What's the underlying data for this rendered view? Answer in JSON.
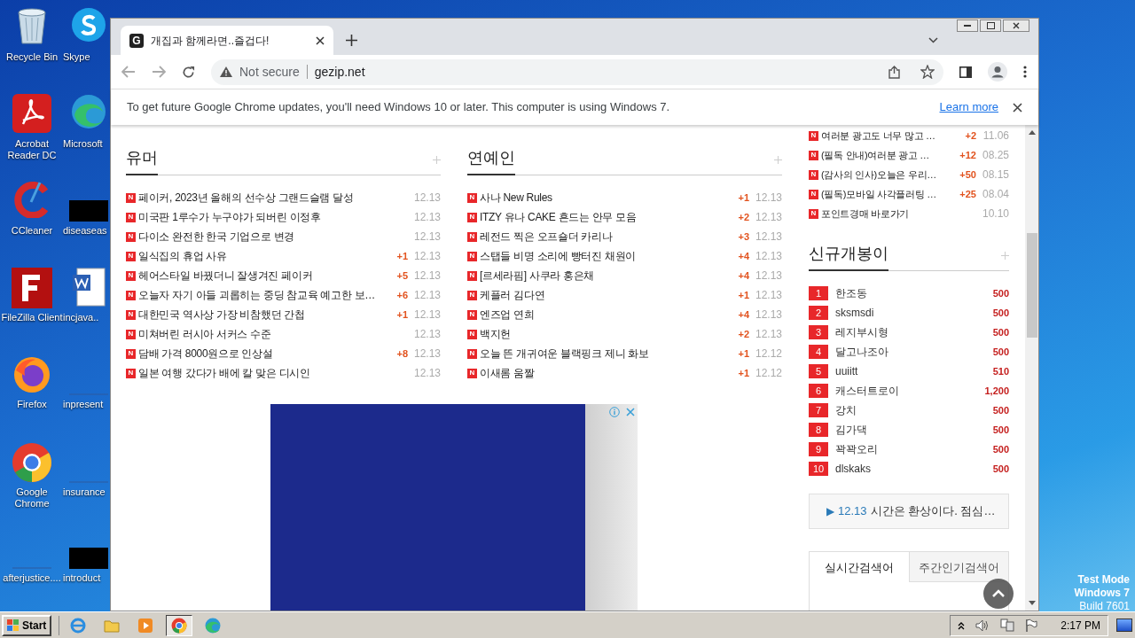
{
  "desktop": {
    "icons": [
      {
        "label": "Recycle Bin",
        "kind": "recycle"
      },
      {
        "label": "Acrobat Reader DC",
        "kind": "acrobat"
      },
      {
        "label": "CCleaner",
        "kind": "ccleaner"
      },
      {
        "label": "FileZilla Client",
        "kind": "filezilla"
      },
      {
        "label": "Firefox",
        "kind": "firefox"
      },
      {
        "label": "Google Chrome",
        "kind": "chrome"
      },
      {
        "label": "afterjustice....",
        "kind": "blank"
      },
      {
        "label": "Skype",
        "kind": "skype"
      },
      {
        "label": "Microsoft",
        "kind": "edge"
      },
      {
        "label": "diseaseas",
        "kind": "black"
      },
      {
        "label": "incjava..",
        "kind": "word"
      },
      {
        "label": "inpresent",
        "kind": "blank"
      },
      {
        "label": "insurance",
        "kind": "blank"
      },
      {
        "label": "introduct",
        "kind": "black"
      }
    ],
    "watermark": [
      "Test Mode",
      "Windows 7",
      "Build 7601"
    ]
  },
  "browser": {
    "tab": {
      "favicon": "G",
      "title": "개집과 함께라면..즐겁다!"
    },
    "address": {
      "security": "Not secure",
      "url": "gezip.net"
    },
    "infobar": {
      "message": "To get future Google Chrome updates, you'll need Windows 10 or later. This computer is using Windows 7.",
      "link": "Learn more"
    }
  },
  "page": {
    "sections": [
      {
        "title": "유머",
        "rows": [
          {
            "badge": "N",
            "title": "페이커, 2023년 올해의 선수상 그랜드슬램 달성",
            "date": "12.13"
          },
          {
            "badge": "N",
            "title": "미국판 1루수가 누구야가 되버린 이정후",
            "date": "12.13"
          },
          {
            "badge": "N",
            "title": "다이소 완전한 한국 기업으로 변경",
            "date": "12.13"
          },
          {
            "badge": "N",
            "title": "일식집의 휴업 사유",
            "count": "+1",
            "date": "12.13"
          },
          {
            "badge": "N",
            "title": "헤어스타일 바꿨더니 잘생겨진 페이커",
            "count": "+5",
            "date": "12.13"
          },
          {
            "badge": "N",
            "title": "오늘자 자기 아들 괴롭히는 중딩 참교육 예고한 보…",
            "count": "+6",
            "date": "12.13"
          },
          {
            "badge": "N",
            "title": "대한민국 역사상 가장 비참했던 간첩",
            "count": "+1",
            "date": "12.13"
          },
          {
            "badge": "N",
            "title": "미쳐버린 러시아 서커스 수준",
            "date": "12.13"
          },
          {
            "badge": "N",
            "title": "담배 가격 8000원으로 인상설",
            "count": "+8",
            "date": "12.13"
          },
          {
            "badge": "N",
            "title": "일본 여행 갔다가 배에 칼 맞은 디시인",
            "date": "12.13"
          }
        ]
      },
      {
        "title": "연예인",
        "rows": [
          {
            "badge": "N",
            "title": "사나 New Rules",
            "count": "+1",
            "date": "12.13"
          },
          {
            "badge": "N",
            "title": "ITZY 유나 CAKE 흔드는 안무 모음",
            "count": "+2",
            "date": "12.13"
          },
          {
            "badge": "N",
            "title": "레전드 찍은 오프숄더 카리나",
            "count": "+3",
            "date": "12.13"
          },
          {
            "badge": "N",
            "title": "스탭들 비명 소리에 빵터진 채원이",
            "count": "+4",
            "date": "12.13"
          },
          {
            "badge": "N",
            "title": "[르세라핌] 사쿠라 홍은채",
            "count": "+4",
            "date": "12.13"
          },
          {
            "badge": "N",
            "title": "케플러 김다연",
            "count": "+1",
            "date": "12.13"
          },
          {
            "badge": "N",
            "title": "엔즈업 연희",
            "count": "+4",
            "date": "12.13"
          },
          {
            "badge": "N",
            "title": "백지헌",
            "count": "+2",
            "date": "12.13"
          },
          {
            "badge": "N",
            "title": "오늘 뜬 개귀여운 블랙핑크 제니 화보",
            "count": "+1",
            "date": "12.12"
          },
          {
            "badge": "N",
            "title": "이새롬 움짤",
            "count": "+1",
            "date": "12.12"
          }
        ]
      }
    ],
    "side_list": [
      {
        "badge": "N",
        "title": "여러분 광고도 너무 많고 …",
        "count": "+2",
        "date": "11.06"
      },
      {
        "badge": "N",
        "title": "(필독 안내)여러분 광고 …",
        "count": "+12",
        "date": "08.25"
      },
      {
        "badge": "N",
        "title": "(감사의 인사)오늘은 우리…",
        "count": "+50",
        "date": "08.15"
      },
      {
        "badge": "N",
        "title": "(필독)모바일 사각플러팅 …",
        "count": "+25",
        "date": "08.04"
      },
      {
        "badge": "N",
        "title": "포인트경매 바로가기",
        "date": "10.10"
      }
    ],
    "ranking": {
      "title": "신규개봉이",
      "rows": [
        {
          "rank": "1",
          "name": "한조동",
          "value": "500"
        },
        {
          "rank": "2",
          "name": "sksmsdi",
          "value": "500"
        },
        {
          "rank": "3",
          "name": "레지부시형",
          "value": "500"
        },
        {
          "rank": "4",
          "name": "달고나조아",
          "value": "500"
        },
        {
          "rank": "5",
          "name": "uuiitt",
          "value": "510"
        },
        {
          "rank": "6",
          "name": "캐스터트로이",
          "value": "1,200"
        },
        {
          "rank": "7",
          "name": "강치",
          "value": "500"
        },
        {
          "rank": "8",
          "name": "김가댁",
          "value": "500"
        },
        {
          "rank": "9",
          "name": "꽉꽉오리",
          "value": "500"
        },
        {
          "rank": "10",
          "name": "dlskaks",
          "value": "500"
        }
      ]
    },
    "notice": {
      "marker": "▶",
      "date": "12.13",
      "text": "시간은 환상이다. 점심…"
    },
    "search_tabs": [
      {
        "label": "실시간검색어",
        "selected": true
      },
      {
        "label": "주간인기검색어",
        "selected": false
      }
    ]
  },
  "taskbar": {
    "start": "Start",
    "apps": [
      {
        "kind": "ie",
        "active": false
      },
      {
        "kind": "folder",
        "active": false
      },
      {
        "kind": "media",
        "active": false
      },
      {
        "kind": "chrome",
        "active": true
      },
      {
        "kind": "edge",
        "active": false
      }
    ],
    "clock": "2:17 PM"
  }
}
